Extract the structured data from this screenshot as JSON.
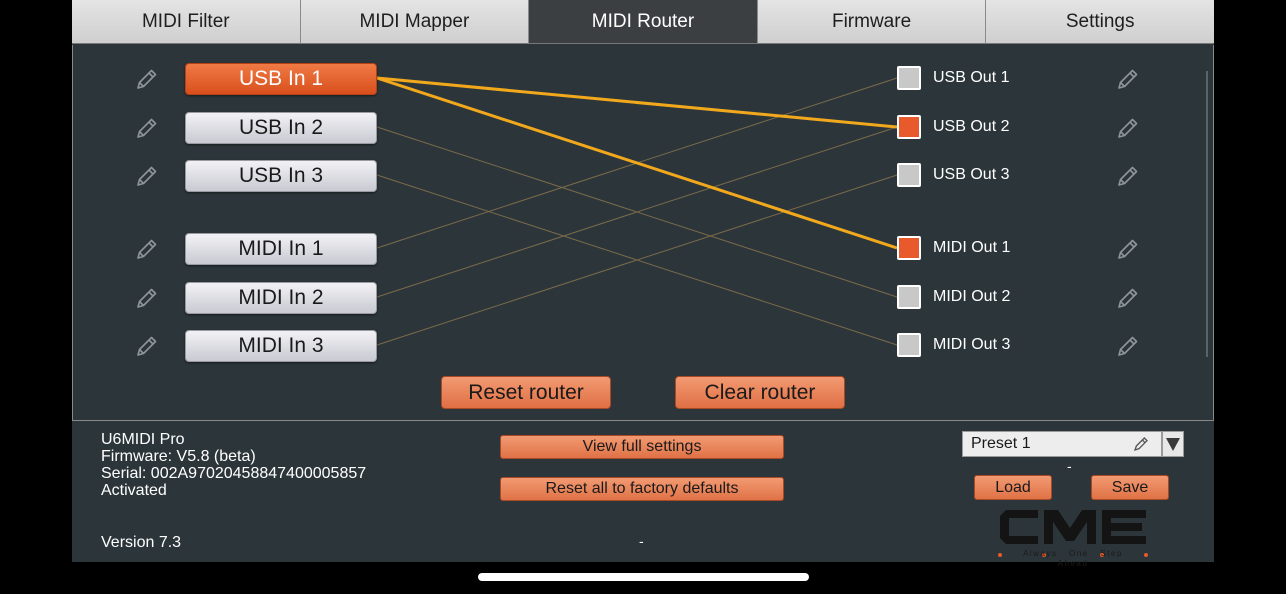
{
  "tabs": [
    {
      "label": "MIDI Filter",
      "active": false
    },
    {
      "label": "MIDI Mapper",
      "active": false
    },
    {
      "label": "MIDI Router",
      "active": true
    },
    {
      "label": "Firmware",
      "active": false
    },
    {
      "label": "Settings",
      "active": false
    }
  ],
  "router": {
    "inputs": [
      {
        "label": "USB In 1",
        "selected": true
      },
      {
        "label": "USB In 2",
        "selected": false
      },
      {
        "label": "USB In 3",
        "selected": false
      },
      {
        "label": "MIDI In 1",
        "selected": false
      },
      {
        "label": "MIDI In 2",
        "selected": false
      },
      {
        "label": "MIDI In 3",
        "selected": false
      }
    ],
    "outputs": [
      {
        "label": "USB Out 1",
        "checked": false
      },
      {
        "label": "USB Out 2",
        "checked": true
      },
      {
        "label": "USB Out 3",
        "checked": false
      },
      {
        "label": "MIDI Out 1",
        "checked": true
      },
      {
        "label": "MIDI Out 2",
        "checked": false
      },
      {
        "label": "MIDI Out 3",
        "checked": false
      }
    ],
    "active_routes": [
      {
        "from": "USB In 1",
        "to": "USB Out 2"
      },
      {
        "from": "USB In 1",
        "to": "MIDI Out 1"
      }
    ],
    "faint_routes": [
      {
        "from": "USB In 2",
        "to": "MIDI Out 2"
      },
      {
        "from": "USB In 3",
        "to": "MIDI Out 3"
      },
      {
        "from": "MIDI In 1",
        "to": "USB Out 1"
      },
      {
        "from": "MIDI In 2",
        "to": "USB Out 2"
      },
      {
        "from": "MIDI In 3",
        "to": "USB Out 3"
      }
    ],
    "reset_label": "Reset router",
    "clear_label": "Clear router"
  },
  "device": {
    "name": "U6MIDI Pro",
    "firmware": "Firmware: V5.8 (beta)",
    "serial": "Serial: 002A97020458847400005857",
    "status": "Activated",
    "version": "Version 7.3"
  },
  "actions": {
    "view_settings": "View full settings",
    "factory_reset": "Reset all to factory defaults"
  },
  "preset": {
    "selected": "Preset 1",
    "dash": "-",
    "load_label": "Load",
    "save_label": "Save"
  },
  "footer": {
    "center_dash": "-"
  },
  "logo": {
    "text": "CME",
    "tagline": "Always One Step Ahead"
  },
  "colors": {
    "background": "#2c363a",
    "accent": "#e8592b",
    "active_wire": "#f2a81d",
    "faint_wire": "#7a6a4a"
  },
  "icons": {
    "edit": "pencil-icon",
    "dropdown": "triangle-down-icon"
  }
}
